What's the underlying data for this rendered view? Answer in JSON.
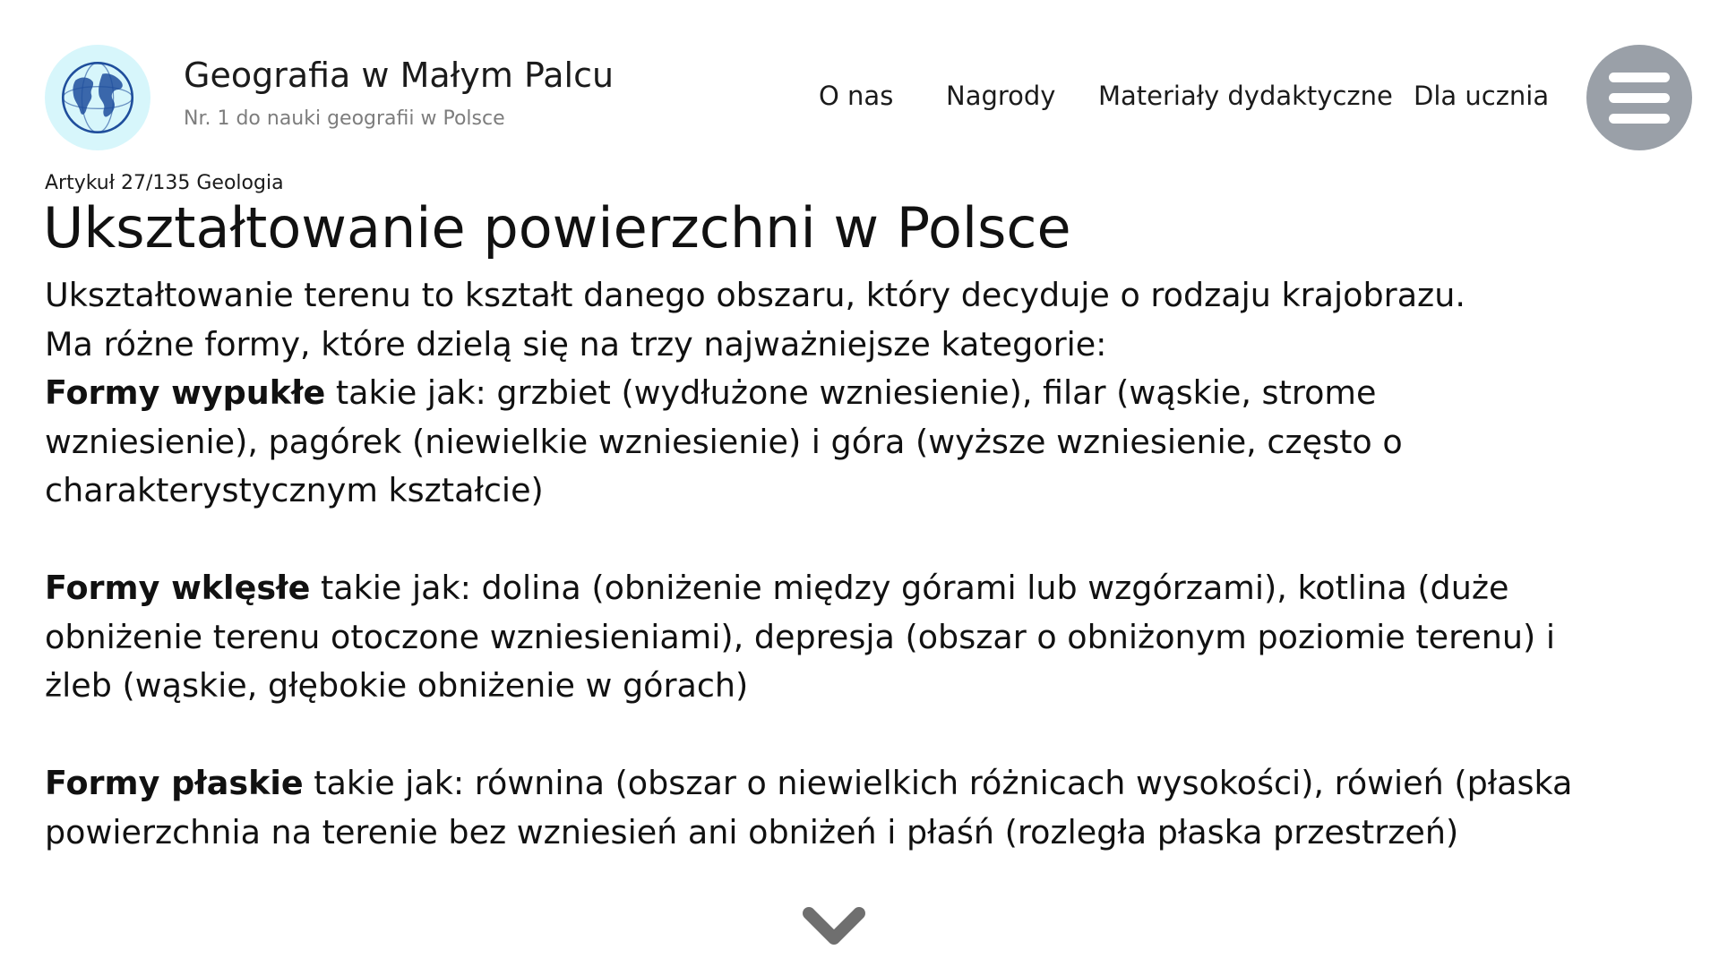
{
  "site": {
    "title": "Geografia w Małym Palcu",
    "subtitle": "Nr. 1 do nauki geografii w Polsce",
    "logo_icon": "globe-icon"
  },
  "nav": {
    "items": [
      {
        "label": "O nas"
      },
      {
        "label": "Nagrody"
      },
      {
        "label": "Materiały dydaktyczne"
      },
      {
        "label": "Dla ucznia"
      }
    ],
    "menu_icon": "hamburger-menu-icon"
  },
  "article": {
    "breadcrumb": "Artykuł 27/135 Geologia",
    "title": "Ukształtowanie powierzchni w Polsce",
    "intro_1": "Ukształtowanie terenu to kształt danego obszaru, który decyduje o rodzaju krajobrazu.",
    "intro_2": "Ma różne formy, które dzielą się na trzy najważniejsze kategorie:",
    "sections": [
      {
        "label": "Formy wypukłe",
        "text": " takie jak: grzbiet (wydłużone wzniesienie), filar (wąskie, strome wzniesienie), pagórek (niewielkie wzniesienie) i góra (wyższe wzniesienie, często o charakterystycznym kształcie)"
      },
      {
        "label": "Formy wklęsłe",
        "text": " takie jak: dolina (obniżenie między górami lub wzgórzami), kotlina (duże obniżenie terenu otoczone wzniesieniami), depresja (obszar o obniżonym poziomie terenu) i żleb (wąskie, głębokie obniżenie w górach)"
      },
      {
        "label": "Formy płaskie",
        "text": " takie jak: równina (obszar o niewielkich różnicach wysokości), rówień (płaska powierzchnia na terenie bez wzniesień ani obniżeń i płaśń (rozległa płaska przestrzeń)"
      }
    ]
  },
  "scroll_icon": "chevron-down-icon",
  "colors": {
    "logo_bg": "#d7f6fb",
    "globe": "#1f4e9c",
    "menu_bg": "#9aa0a8",
    "chevron": "#6f6f6f"
  }
}
